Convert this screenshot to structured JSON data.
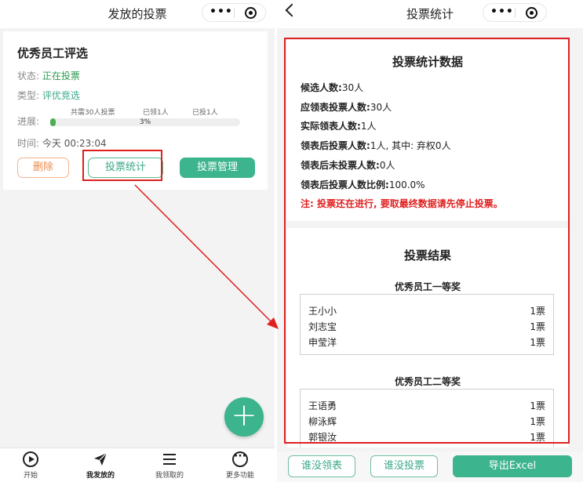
{
  "left": {
    "nav_title": "发放的投票",
    "card": {
      "title": "优秀员工评选",
      "status_label": "状态:",
      "status_value": "正在投票",
      "type_label": "类型:",
      "type_value": "评优竞选",
      "progress_label": "进展:",
      "progress_total": "共需30人投票",
      "progress_received": "已领1人",
      "progress_voted": "已投1人",
      "progress_percent": "3%",
      "progress_fraction": 0.03,
      "time_label": "时间:",
      "time_value": "今天 00:23:04",
      "delete_label": "删除",
      "stats_label": "投票统计",
      "manage_label": "投票管理"
    },
    "fab_icon": "plus-icon",
    "tabs": [
      {
        "label": "开始",
        "icon": "play-icon"
      },
      {
        "label": "我发放的",
        "icon": "send-icon"
      },
      {
        "label": "我领取的",
        "icon": "list-icon"
      },
      {
        "label": "更多功能",
        "icon": "more-icon"
      }
    ]
  },
  "right": {
    "nav_title": "投票统计",
    "stats": {
      "title": "投票统计数据",
      "candidates_label": "候选人数:",
      "candidates_value": "30人",
      "should_label": "应领表投票人数:",
      "should_value": "30人",
      "actual_label": "实际领表人数:",
      "actual_value": "1人",
      "voted_label": "领表后投票人数:",
      "voted_value": "1人, 其中: 弃权0人",
      "notvoted_label": "领表后未投票人数:",
      "notvoted_value": "0人",
      "ratio_label": "领表后投票人数比例:",
      "ratio_value": "100.0%",
      "note": "注: 投票还在进行, 要取最终数据请先停止投票。"
    },
    "results": {
      "title": "投票结果",
      "groups": [
        {
          "title": "优秀员工一等奖",
          "candidates": [
            {
              "name": "王小小",
              "votes": "1票"
            },
            {
              "name": "刘志宝",
              "votes": "1票"
            },
            {
              "name": "申莹洋",
              "votes": "1票"
            }
          ]
        },
        {
          "title": "优秀员工二等奖",
          "candidates": [
            {
              "name": "王语勇",
              "votes": "1票"
            },
            {
              "name": "柳泳辉",
              "votes": "1票"
            },
            {
              "name": "郭银汝",
              "votes": "1票"
            }
          ]
        }
      ]
    },
    "bottom": {
      "not_received_label": "谁没领表",
      "not_voted_label": "谁没投票",
      "export_label": "导出Excel"
    }
  },
  "colors": {
    "accent": "#3cb48d",
    "highlight": "#e02020",
    "status_green": "#2b9a4d",
    "delete_orange": "#ee8a4c"
  }
}
